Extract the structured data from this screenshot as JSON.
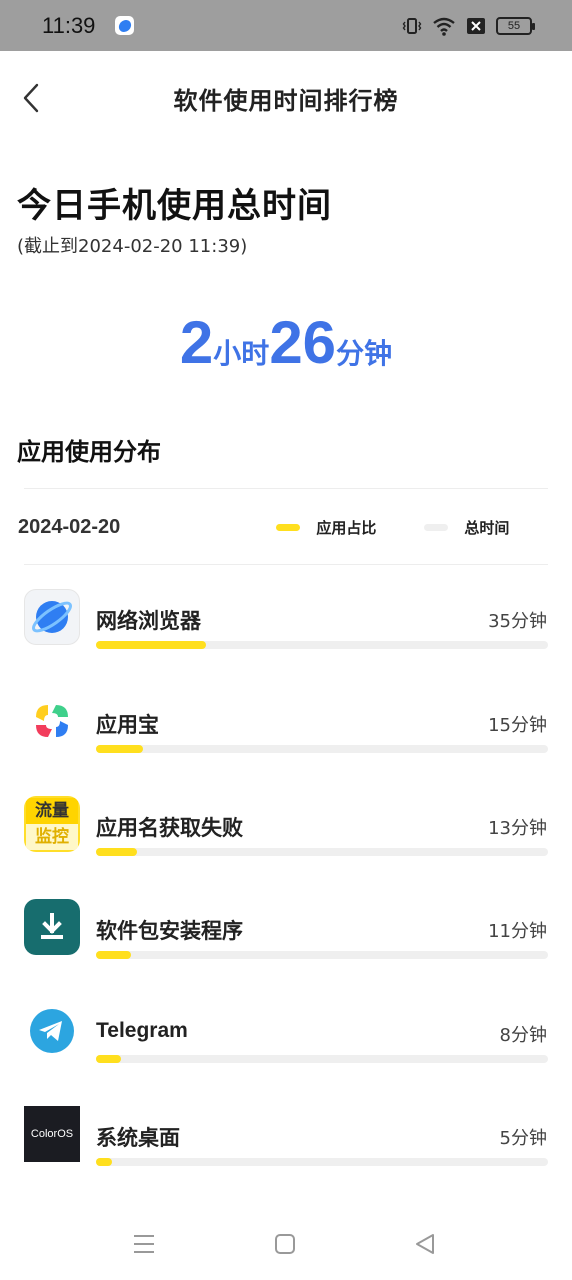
{
  "status_bar": {
    "time": "11:39",
    "battery": "55",
    "icons": [
      "app-notification-icon",
      "vibrate-icon",
      "wifi-icon",
      "sim-error-icon",
      "battery-icon"
    ]
  },
  "header": {
    "title": "软件使用时间排行榜",
    "back_icon": "chevron-left-icon"
  },
  "summary": {
    "title": "今日手机使用总时间",
    "subtitle": "(截止到2024-02-20 11:39)",
    "hours": "2",
    "hours_unit": "小时",
    "minutes": "26",
    "minutes_unit": "分钟",
    "color": "#3f73e6"
  },
  "distribution": {
    "title": "应用使用分布",
    "date": "2024-02-20",
    "legend": [
      {
        "label": "应用占比",
        "color": "#ffdf1e"
      },
      {
        "label": "总时间",
        "color": "#efefef"
      }
    ],
    "apps": [
      {
        "name": "网络浏览器",
        "time": "35分钟",
        "minutes": 35,
        "icon": "browser-planet-icon"
      },
      {
        "name": "应用宝",
        "time": "15分钟",
        "minutes": 15,
        "icon": "app-store-icon"
      },
      {
        "name": "应用名获取失败",
        "time": "13分钟",
        "minutes": 13,
        "icon": "traffic-monitor-icon",
        "icon_text": [
          "流量",
          "监控"
        ]
      },
      {
        "name": "软件包安装程序",
        "time": "11分钟",
        "minutes": 11,
        "icon": "package-installer-icon"
      },
      {
        "name": "Telegram",
        "time": "8分钟",
        "minutes": 8,
        "icon": "telegram-icon"
      },
      {
        "name": "系统桌面",
        "time": "5分钟",
        "minutes": 5,
        "icon": "coloros-launcher-icon",
        "icon_text": [
          "ColorOS"
        ]
      }
    ]
  },
  "nav_bar": {
    "items": [
      "menu-icon",
      "home-icon",
      "back-triangle-icon"
    ]
  }
}
